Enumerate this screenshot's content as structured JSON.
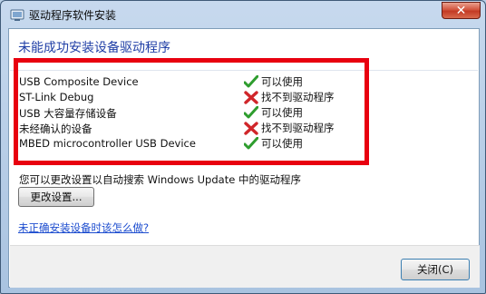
{
  "window": {
    "title": "驱动程序软件安装",
    "close_glyph": "✕"
  },
  "main": {
    "heading": "未能成功安装设备驱动程序",
    "devices": [
      {
        "name": "USB Composite Device",
        "status": "可以使用",
        "status_icon": "check-icon"
      },
      {
        "name": "ST-Link Debug",
        "status": "找不到驱动程序",
        "status_icon": "error-x-icon"
      },
      {
        "name": "USB 大容量存储设备",
        "status": "可以使用",
        "status_icon": "check-icon"
      },
      {
        "name": "未经确认的设备",
        "status": "找不到驱动程序",
        "status_icon": "error-x-icon"
      },
      {
        "name": "MBED microcontroller USB Device",
        "status": "可以使用",
        "status_icon": "check-icon"
      }
    ],
    "info_text": "您可以更改设置以自动搜索 Windows Update 中的驱动程序",
    "change_settings_label": "更改设置...",
    "help_link": "未正确安装设备时该怎么做?"
  },
  "footer": {
    "close_label": "关闭(C)"
  },
  "colors": {
    "heading": "#1f3ea6",
    "link": "#1c4ccf",
    "highlight_outline": "#e8000f",
    "check": "#2e9d2e",
    "error": "#d0262a"
  }
}
